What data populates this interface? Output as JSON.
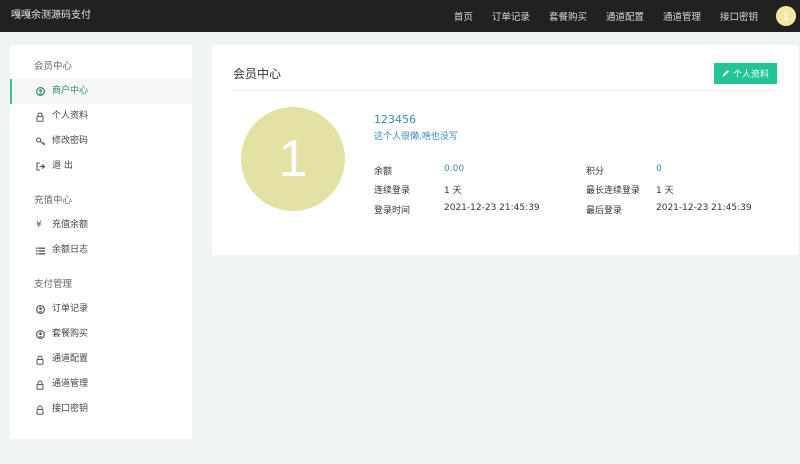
{
  "header": {
    "brand": "嘎嘎余测源码支付",
    "nav": [
      "首页",
      "订单记录",
      "套餐购买",
      "通道配置",
      "通道管理",
      "接口密钥"
    ],
    "avatar": "1"
  },
  "sidebar": {
    "groups": [
      {
        "title": "会员中心",
        "items": [
          {
            "label": "商户中心",
            "icon": "user-circle-icon",
            "active": true
          },
          {
            "label": "个人资料",
            "icon": "lock-icon"
          },
          {
            "label": "修改密码",
            "icon": "key-icon"
          },
          {
            "label": "退 出",
            "icon": "sign-out-icon"
          }
        ]
      },
      {
        "title": "充值中心",
        "items": [
          {
            "label": "充值余额",
            "icon": "yen-icon"
          },
          {
            "label": "余额日志",
            "icon": "list-icon"
          }
        ]
      },
      {
        "title": "支付管理",
        "items": [
          {
            "label": "订单记录",
            "icon": "user-circle-icon"
          },
          {
            "label": "套餐购买",
            "icon": "user-circle-icon"
          },
          {
            "label": "通道配置",
            "icon": "lock-icon"
          },
          {
            "label": "通道管理",
            "icon": "lock-icon"
          },
          {
            "label": "接口密钥",
            "icon": "lock-icon"
          }
        ]
      }
    ]
  },
  "main": {
    "title": "会员中心",
    "profile_button": "个人资料",
    "avatar": "1",
    "username": "123456",
    "signature": "这个人很懒,啥也没写",
    "stats": {
      "balance_label": "余额",
      "balance_value": "0.00",
      "points_label": "积分",
      "points_value": "0",
      "streak_label": "连续登录",
      "streak_value": "1 天",
      "max_streak_label": "最长连续登录",
      "max_streak_value": "1 天",
      "login_time_label": "登录时间",
      "login_time_value": "2021-12-23 21:45:39",
      "last_login_label": "最后登录",
      "last_login_value": "2021-12-23 21:45:39"
    }
  },
  "colors": {
    "topbar": "#212121",
    "accent": "#21c494",
    "link": "#3a88be",
    "avatar": "#e3e1a4"
  }
}
